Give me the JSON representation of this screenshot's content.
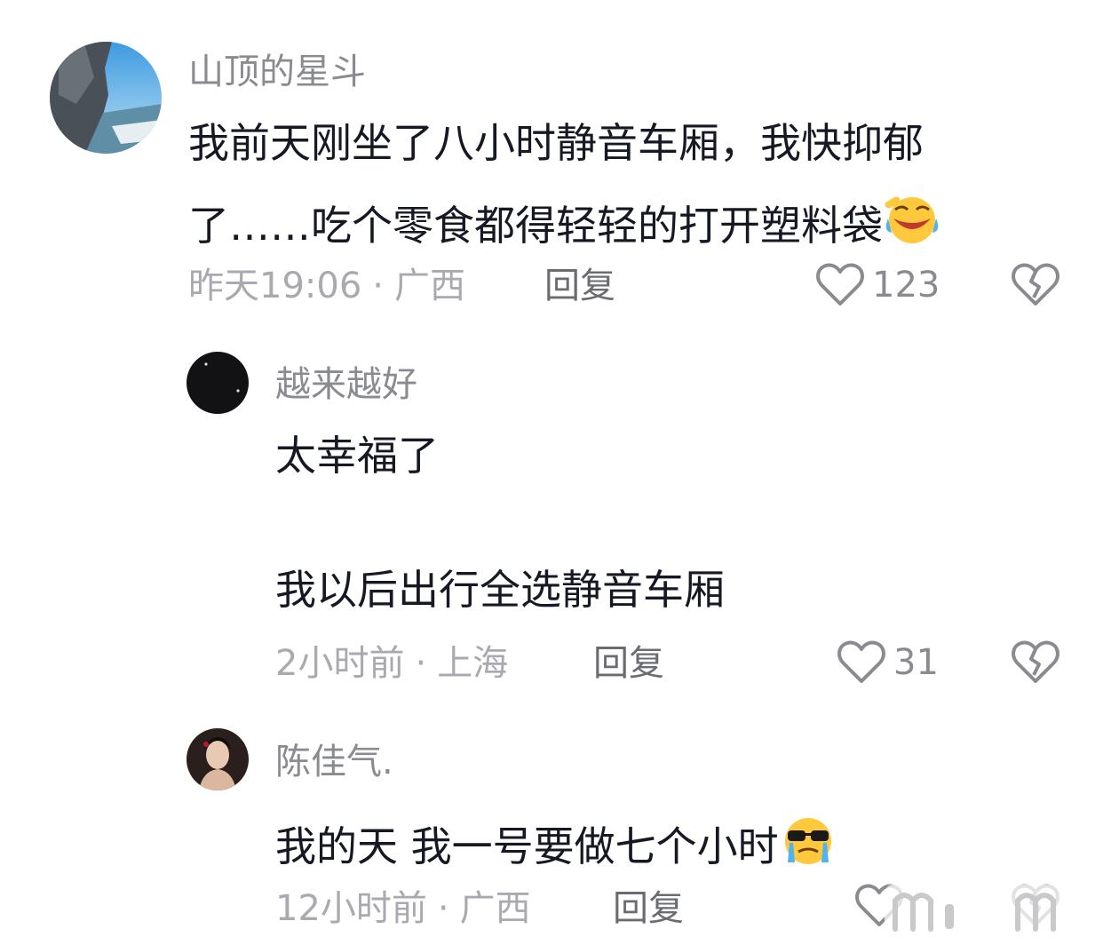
{
  "comments": [
    {
      "username": "山顶的星斗",
      "text_line1": "我前天刚坐了八小时静音车厢，我快抑郁",
      "text_line2": "了……吃个零食都得轻轻的打开塑料袋",
      "emoji": "laughing-crying-emoji",
      "time": "昨天19:06",
      "location": "广西",
      "reply_label": "回复",
      "likes": "123"
    },
    {
      "username": "越来越好",
      "text_line1": "太幸福了",
      "text_line2": "我以后出行全选静音车厢",
      "time": "2小时前",
      "location": "上海",
      "reply_label": "回复",
      "likes": "31"
    },
    {
      "username": "陈佳气.",
      "text_line1": "我的天 我一号要做七个小时",
      "emoji": "crying-sunglasses-emoji",
      "time": "12小时前",
      "location": "广西",
      "reply_label": "回复"
    }
  ],
  "meta_separator": "·",
  "icons": {
    "like": "heart-outline-icon",
    "dislike": "broken-heart-icon"
  },
  "colors": {
    "username": "#8a8b91",
    "meta": "#a9aab0",
    "text": "#161823"
  }
}
